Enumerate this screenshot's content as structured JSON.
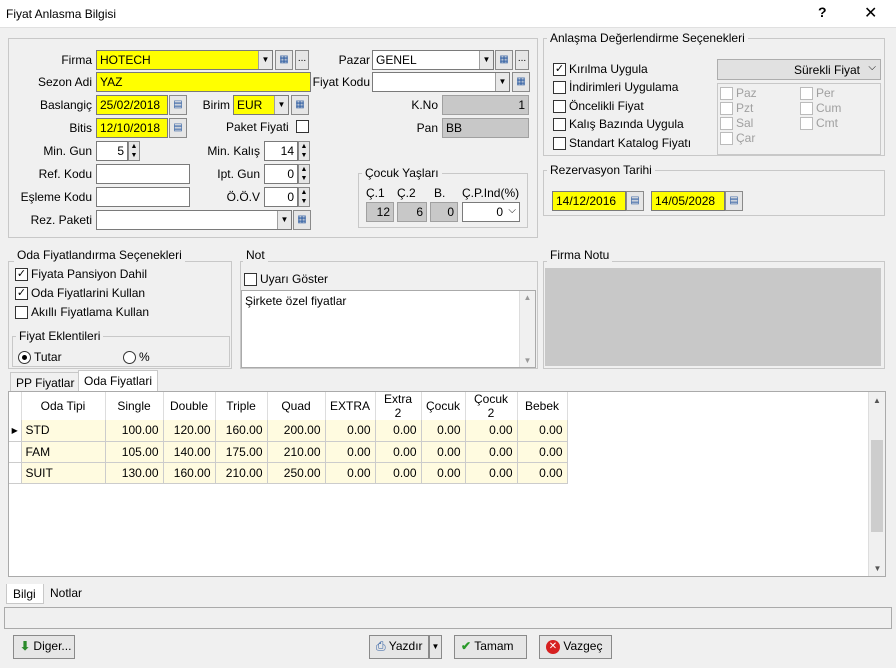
{
  "window": {
    "title": "Fiyat Anlasma Bilgisi",
    "help": "?",
    "close": "✕"
  },
  "form": {
    "firma_label": "Firma",
    "firma_value": "HOTECH",
    "sezon_label": "Sezon Adi",
    "sezon_value": "YAZ",
    "baslangic_label": "Baslangiç",
    "baslangic_value": "25/02/2018",
    "bitis_label": "Bitis",
    "bitis_value": "12/10/2018",
    "min_gun_label": "Min. Gun",
    "min_gun_value": "5",
    "ref_kodu_label": "Ref. Kodu",
    "ref_kodu_value": "",
    "esleme_kodu_label": "Eşleme Kodu",
    "esleme_kodu_value": "",
    "rez_paketi_label": "Rez. Paketi",
    "rez_paketi_value": "",
    "birim_label": "Birim",
    "birim_value": "EUR",
    "paket_fiyati_label": "Paket Fiyati",
    "min_kalis_label": "Min. Kalış",
    "min_kalis_value": "14",
    "ipt_gun_label": "Ipt. Gun",
    "ipt_gun_value": "0",
    "oov_label": "Ö.Ö.V",
    "oov_value": "0",
    "pazar_label": "Pazar",
    "pazar_value": "GENEL",
    "fiyat_kodu_label": "Fiyat Kodu",
    "fiyat_kodu_value": "",
    "kno_label": "K.No",
    "kno_value": "1",
    "pan_label": "Pan",
    "pan_value": "BB",
    "dots": "..."
  },
  "cocuk": {
    "title": "Çocuk Yaşları",
    "c1_label": "Ç.1",
    "c2_label": "Ç.2",
    "b_label": "B.",
    "cpind_label": "Ç.P.Ind(%)",
    "c1": "12",
    "c2": "6",
    "b": "0",
    "cpind": "0"
  },
  "degerlendirme": {
    "title": "Anlaşma Değerlendirme Seçenekleri",
    "items": [
      {
        "label": "Kırılma Uygula",
        "checked": "✓"
      },
      {
        "label": "İndirimleri Uygulama",
        "checked": ""
      },
      {
        "label": "Öncelikli Fiyat",
        "checked": ""
      },
      {
        "label": "Kalış Bazında Uygula",
        "checked": ""
      },
      {
        "label": "Standart Katalog Fiyatı",
        "checked": ""
      }
    ],
    "surekli": "Sürekli Fiyat",
    "days": [
      "Paz",
      "Per",
      "Pzt",
      "Cum",
      "Sal",
      "Cmt",
      "Çar"
    ]
  },
  "rezervasyon": {
    "title": "Rezervasyon Tarihi",
    "from": "14/12/2016",
    "to": "14/05/2028"
  },
  "oda": {
    "title": "Oda Fiyatlandırma Seçenekleri",
    "items": [
      {
        "label": "Fiyata Pansiyon Dahil",
        "checked": "✓"
      },
      {
        "label": "Oda Fiyatlarini Kullan",
        "checked": "✓"
      },
      {
        "label": "Akıllı Fiyatlama Kullan",
        "checked": ""
      }
    ],
    "ekl_title": "Fiyat Eklentileri",
    "tutar": "Tutar",
    "yuzde": "%"
  },
  "not": {
    "title": "Not",
    "uyari": "Uyarı Göster",
    "text": "Şirkete özel fiyatlar"
  },
  "firma_notu": {
    "title": "Firma Notu"
  },
  "tabs": {
    "pp": "PP Fiyatlar",
    "oda": "Oda Fiyatlari"
  },
  "grid": {
    "columns": [
      "Oda Tipi",
      "Single",
      "Double",
      "Triple",
      "Quad",
      "EXTRA",
      "Extra 2",
      "Çocuk",
      "Çocuk 2",
      "Bebek"
    ],
    "rows": [
      [
        "STD",
        "100.00",
        "120.00",
        "160.00",
        "200.00",
        "0.00",
        "0.00",
        "0.00",
        "0.00",
        "0.00"
      ],
      [
        "FAM",
        "105.00",
        "140.00",
        "175.00",
        "210.00",
        "0.00",
        "0.00",
        "0.00",
        "0.00",
        "0.00"
      ],
      [
        "SUIT",
        "130.00",
        "160.00",
        "210.00",
        "250.00",
        "0.00",
        "0.00",
        "0.00",
        "0.00",
        "0.00"
      ]
    ]
  },
  "bottom_tabs": {
    "bilgi": "Bilgi",
    "notlar": "Notlar"
  },
  "buttons": {
    "diger": "Diger...",
    "yazdir": "Yazdır",
    "tamam": "Tamam",
    "vazgec": "Vazgeç"
  }
}
